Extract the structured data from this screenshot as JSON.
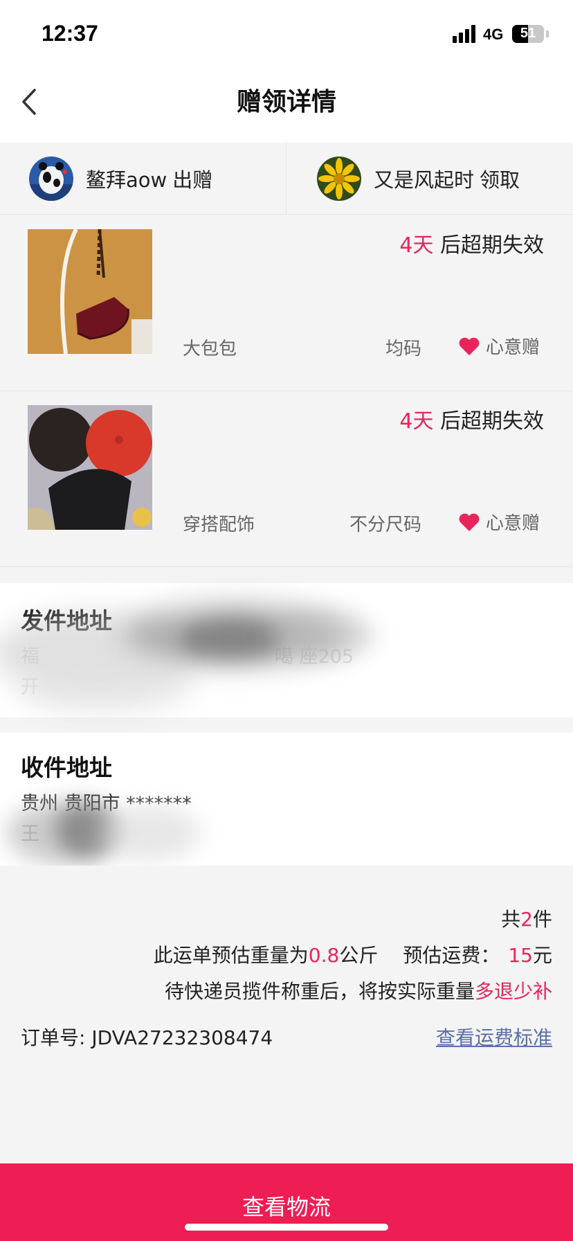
{
  "status_bar": {
    "time": "12:37",
    "network": "4G",
    "battery": "51",
    "battery_fraction": 0.51
  },
  "nav": {
    "title": "赠领详情",
    "back_icon": "chevron-left-icon"
  },
  "users": {
    "giver": {
      "name": "鳌拜aow",
      "role": "出赠"
    },
    "receiver": {
      "name": "又是风起时",
      "role": "领取"
    }
  },
  "gifts": [
    {
      "expire_days": "4天",
      "expire_suffix": "后超期失效",
      "name": "大包包",
      "size": "均码",
      "type": "心意赠"
    },
    {
      "expire_days": "4天",
      "expire_suffix": "后超期失效",
      "name": "穿搭配饰",
      "size": "不分尺码",
      "type": "心意赠"
    }
  ],
  "sender_address": {
    "title": "发件地址",
    "line1": "福",
    "line1_tail": "噶 座205",
    "line2": "开"
  },
  "receiver_address": {
    "title": "收件地址",
    "line1": "贵州 贵阳市 *******",
    "line2": "王"
  },
  "summary": {
    "count_prefix": "共",
    "count": "2",
    "count_suffix": "件",
    "weight_prefix": "此运单预估重量为",
    "weight": "0.8",
    "weight_unit": "公斤",
    "fee_label": "预估运费：",
    "fee": "15",
    "fee_unit": "元",
    "note_prefix": "待快递员揽件称重后，将按实际重量",
    "note_highlight": "多退少补",
    "order_label": "订单号:",
    "order_number": "JDVA27232308474",
    "fee_standard_link": "查看运费标准"
  },
  "bottom_button": "查看物流",
  "colors": {
    "accent": "#ee1d53",
    "highlight_text": "#e8245a",
    "link": "#5b6fa8"
  }
}
